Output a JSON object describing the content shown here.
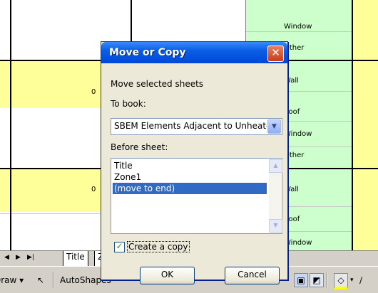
{
  "sheet": {
    "cells": {
      "window": "Window",
      "other_top": "Other",
      "wall_1": "Wall",
      "zero_1": "0",
      "roof_1": "Roof",
      "window_2": "Window",
      "other_2": "Other",
      "zero_2": "0",
      "wall_2": "Wall",
      "roof_2": "Roof",
      "window_3": "Window"
    },
    "colors": {
      "yellow": "#ffff99",
      "green": "#ccffcc"
    }
  },
  "tabbar": {
    "nav_first": "◀",
    "nav_prev": "▶",
    "nav_last": "▶|",
    "tab_title": "Title",
    "tab_next": "Z"
  },
  "drawbar": {
    "draw_label": "Draw ▾",
    "autoshapes_label": "AutoShapes"
  },
  "dialog": {
    "title": "Move or Copy",
    "close_glyph": "✕",
    "move_label": "Move selected sheets",
    "to_book_label": "To book:",
    "to_book_value": "SBEM Elements Adjacent to Unheated",
    "combo_arrow": "▼",
    "before_sheet_label": "Before sheet:",
    "sheets": [
      "Title",
      "Zone1",
      "(move to end)"
    ],
    "selected_index": 2,
    "create_copy_label": "Create a copy",
    "create_copy_checked": true,
    "ok_label": "OK",
    "cancel_label": "Cancel"
  }
}
